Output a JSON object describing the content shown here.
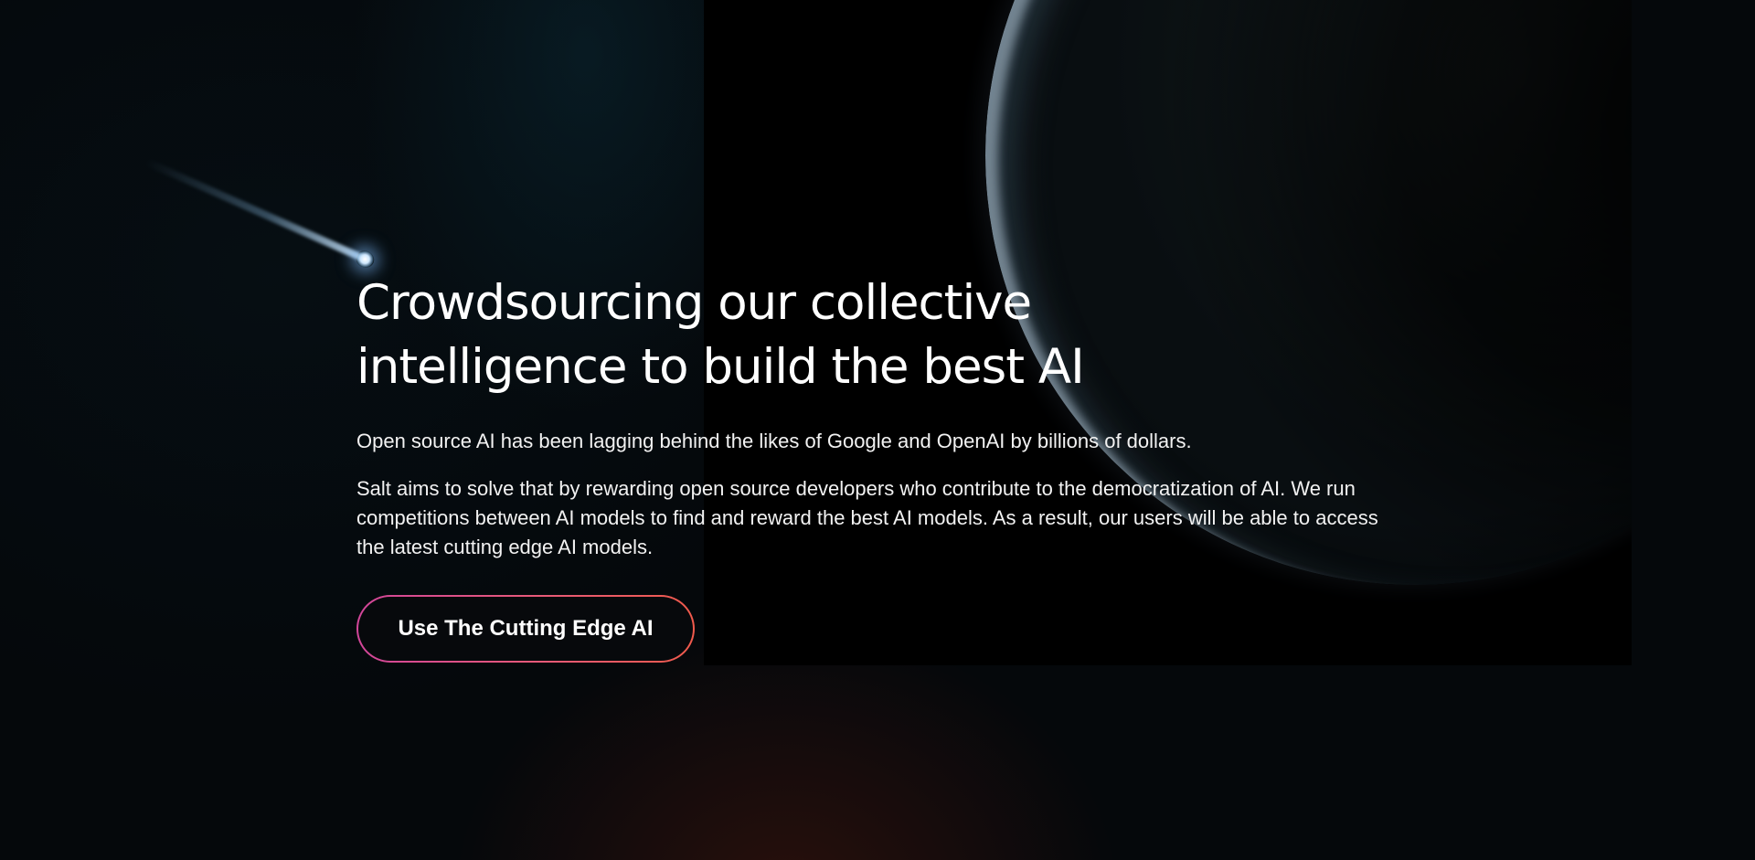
{
  "hero": {
    "title": "Crowdsourcing our collective intelligence to build the best AI",
    "paragraph_1": "Open source AI has been lagging behind the likes of Google and OpenAI by billions of dollars.",
    "paragraph_2": "Salt aims to solve that by rewarding open source developers who contribute to the democratization of AI. We run competitions between AI models to find and reward the best AI models. As a result, our users will be able to access the latest cutting edge AI models.",
    "cta_label": "Use The Cutting Edge AI"
  },
  "colors": {
    "background": "#05080b",
    "text": "#ffffff",
    "cta_gradient_start": "#d2469a",
    "cta_gradient_end": "#f05a4c"
  },
  "decorations": {
    "planet": "planet-illustration",
    "comet": "comet-illustration"
  }
}
